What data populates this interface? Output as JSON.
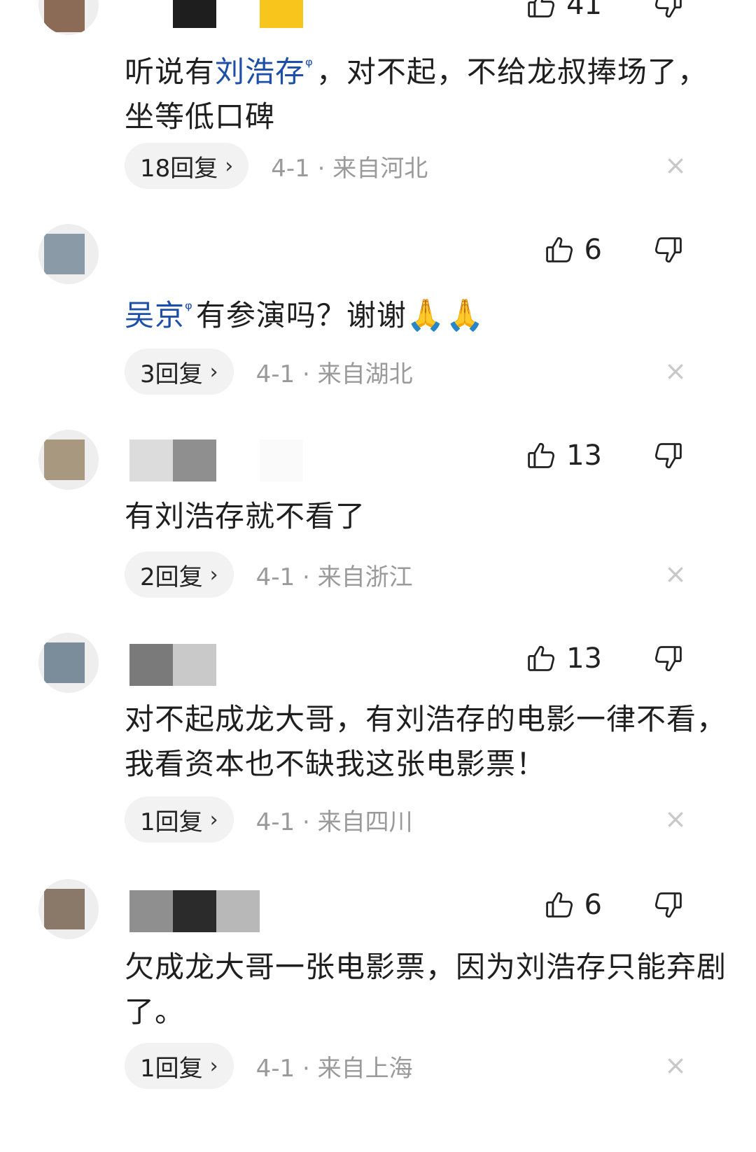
{
  "comments": [
    {
      "likes": "41",
      "text_parts": [
        "听说有",
        "刘浩存",
        "，对不起，不给龙叔捧场了，坐等低口碑"
      ],
      "mention": "刘浩存",
      "replies": "18回复",
      "date_loc": "4-1 · 来自河北"
    },
    {
      "likes": "6",
      "mention": "吴京",
      "text_after": "有参演吗？谢谢",
      "emoji": "🙏🙏",
      "replies": "3回复",
      "date_loc": "4-1 · 来自湖北"
    },
    {
      "likes": "13",
      "text": "有刘浩存就不看了",
      "replies": "2回复",
      "date_loc": "4-1 · 来自浙江"
    },
    {
      "likes": "13",
      "text": "对不起成龙大哥，有刘浩存的电影一律不看，我看资本也不缺我这张电影票！",
      "replies": "1回复",
      "date_loc": "4-1 · 来自四川"
    },
    {
      "likes": "6",
      "text": "欠成龙大哥一张电影票，因为刘浩存只能弃剧了。",
      "replies": "1回复",
      "date_loc": "4-1 · 来自上海"
    }
  ],
  "icons": {
    "like": "thumbs-up-icon",
    "dislike": "thumbs-down-icon",
    "close": "close-icon",
    "chevron": "chevron-right-icon",
    "search_mention": "search-icon"
  },
  "colors": {
    "mention": "#1e4fa8",
    "meta_gray": "#9a9a9a",
    "pill_bg": "#f2f2f2"
  },
  "ui": {
    "chevron": "›",
    "close": "×",
    "search_mark": "ᵠ"
  }
}
